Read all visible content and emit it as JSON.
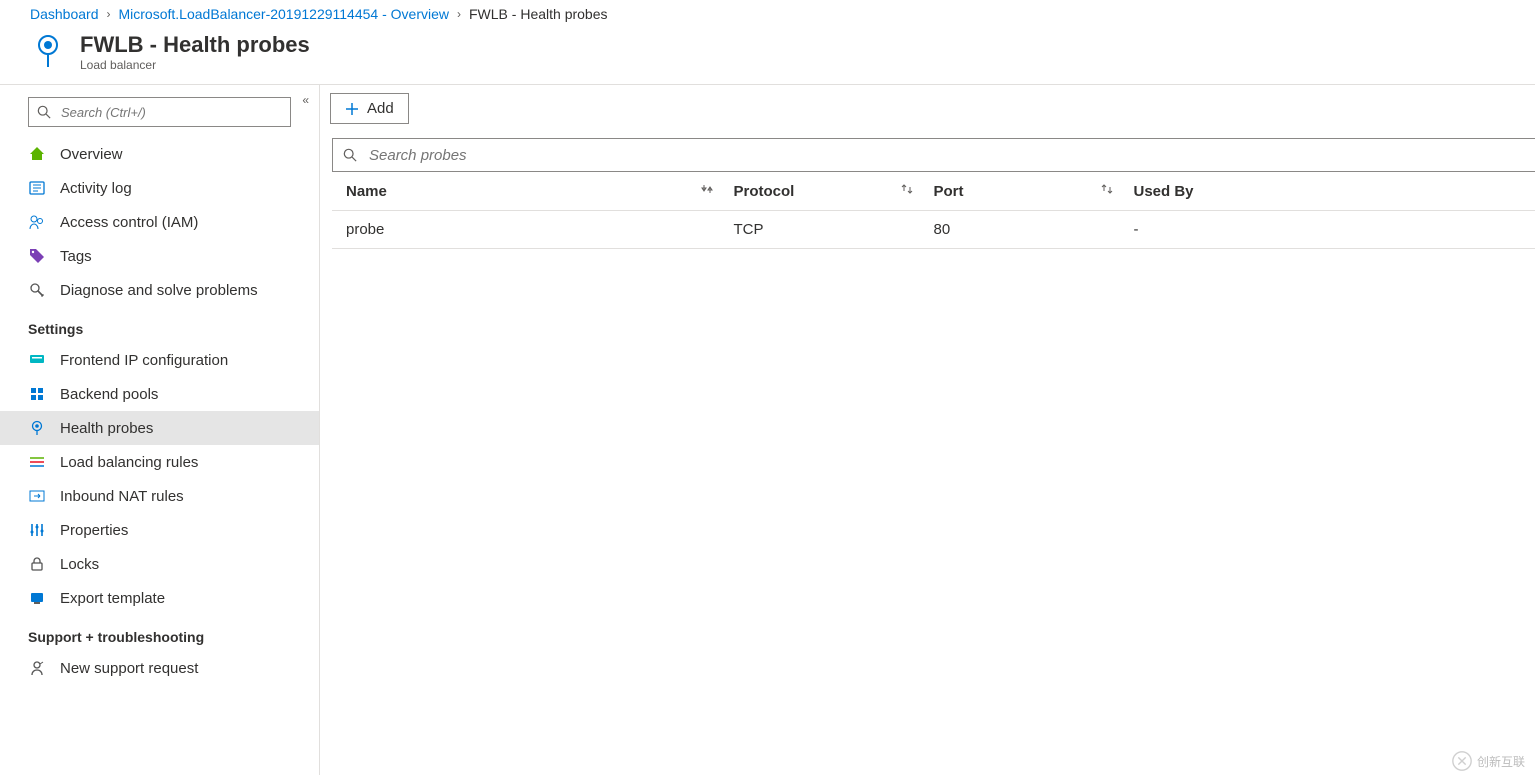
{
  "breadcrumb": {
    "items": [
      {
        "label": "Dashboard",
        "link": true
      },
      {
        "label": "Microsoft.LoadBalancer-20191229114454 - Overview",
        "link": true
      },
      {
        "label": "FWLB - Health probes",
        "link": false
      }
    ]
  },
  "header": {
    "title": "FWLB - Health probes",
    "subtitle": "Load balancer"
  },
  "sidebar": {
    "search_placeholder": "Search (Ctrl+/)",
    "top_items": [
      {
        "label": "Overview",
        "icon": "overview",
        "active": false
      },
      {
        "label": "Activity log",
        "icon": "activity",
        "active": true
      },
      {
        "label": "Access control (IAM)",
        "icon": "iam",
        "active": false
      },
      {
        "label": "Tags",
        "icon": "tags",
        "active": false
      },
      {
        "label": "Diagnose and solve problems",
        "icon": "diagnose",
        "active": false
      }
    ],
    "settings_label": "Settings",
    "settings_items": [
      {
        "label": "Frontend IP configuration",
        "icon": "frontend",
        "active": false
      },
      {
        "label": "Backend pools",
        "icon": "backend",
        "active": false
      },
      {
        "label": "Health probes",
        "icon": "probe",
        "active": true
      },
      {
        "label": "Load balancing rules",
        "icon": "lbrules",
        "active": false
      },
      {
        "label": "Inbound NAT rules",
        "icon": "nat",
        "active": false
      },
      {
        "label": "Properties",
        "icon": "properties",
        "active": false
      },
      {
        "label": "Locks",
        "icon": "locks",
        "active": false
      },
      {
        "label": "Export template",
        "icon": "export",
        "active": false
      }
    ],
    "support_label": "Support + troubleshooting",
    "support_items": [
      {
        "label": "New support request",
        "icon": "support",
        "active": false
      }
    ]
  },
  "toolbar": {
    "add_label": "Add"
  },
  "probe_search": {
    "placeholder": "Search probes"
  },
  "table": {
    "columns": {
      "name": "Name",
      "protocol": "Protocol",
      "port": "Port",
      "used_by": "Used By"
    },
    "rows": [
      {
        "name": "probe",
        "protocol": "TCP",
        "port": "80",
        "used_by": "-"
      }
    ]
  },
  "watermark": "创新互联"
}
